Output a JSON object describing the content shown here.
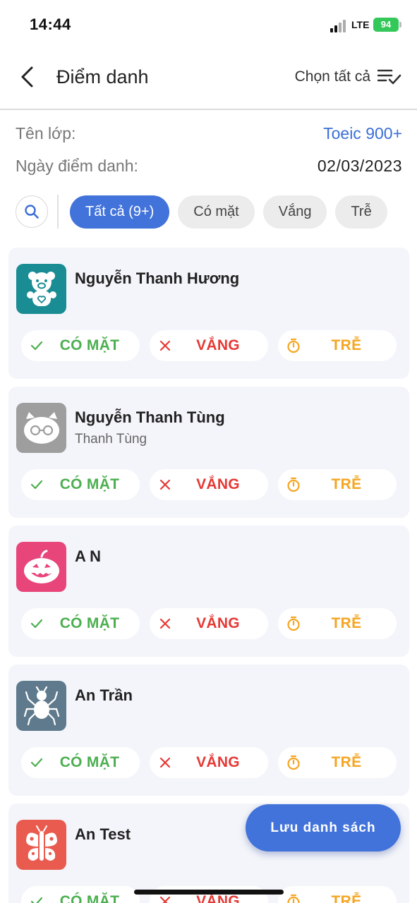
{
  "status_bar": {
    "time": "14:44",
    "network": "LTE",
    "battery": "94"
  },
  "header": {
    "title": "Điểm danh",
    "select_all_label": "Chọn tất cả"
  },
  "info": {
    "class_label": "Tên lớp:",
    "class_value": "Toeic 900+",
    "date_label": "Ngày điểm danh:",
    "date_value": "02/03/2023"
  },
  "filters": [
    {
      "label": "Tất cả (9+)",
      "active": true
    },
    {
      "label": "Có mặt",
      "active": false
    },
    {
      "label": "Vắng",
      "active": false
    },
    {
      "label": "Trễ",
      "active": false
    }
  ],
  "status_labels": {
    "present": "CÓ MẶT",
    "absent": "VẮNG",
    "late": "TRỄ"
  },
  "students": [
    {
      "name": "Nguyễn Thanh Hương",
      "nickname": "",
      "avatar_icon": "teddy-bear-icon",
      "avatar_color": "#1a8c94"
    },
    {
      "name": "Nguyễn Thanh Tùng",
      "nickname": "Thanh Tùng",
      "avatar_icon": "cat-glasses-icon",
      "avatar_color": "#9e9e9e"
    },
    {
      "name": "A N",
      "nickname": "",
      "avatar_icon": "pumpkin-icon",
      "avatar_color": "#e8457a"
    },
    {
      "name": "An Trần",
      "nickname": "",
      "avatar_icon": "spider-icon",
      "avatar_color": "#5e7a8c"
    },
    {
      "name": "An Test",
      "nickname": "",
      "avatar_icon": "butterfly-icon",
      "avatar_color": "#ea5b4f"
    }
  ],
  "save_button_label": "Lưu danh sách",
  "colors": {
    "primary": "#4273da",
    "present": "#4caf50",
    "absent": "#e53935",
    "late": "#f5a623",
    "card_bg": "#f4f5fa"
  }
}
